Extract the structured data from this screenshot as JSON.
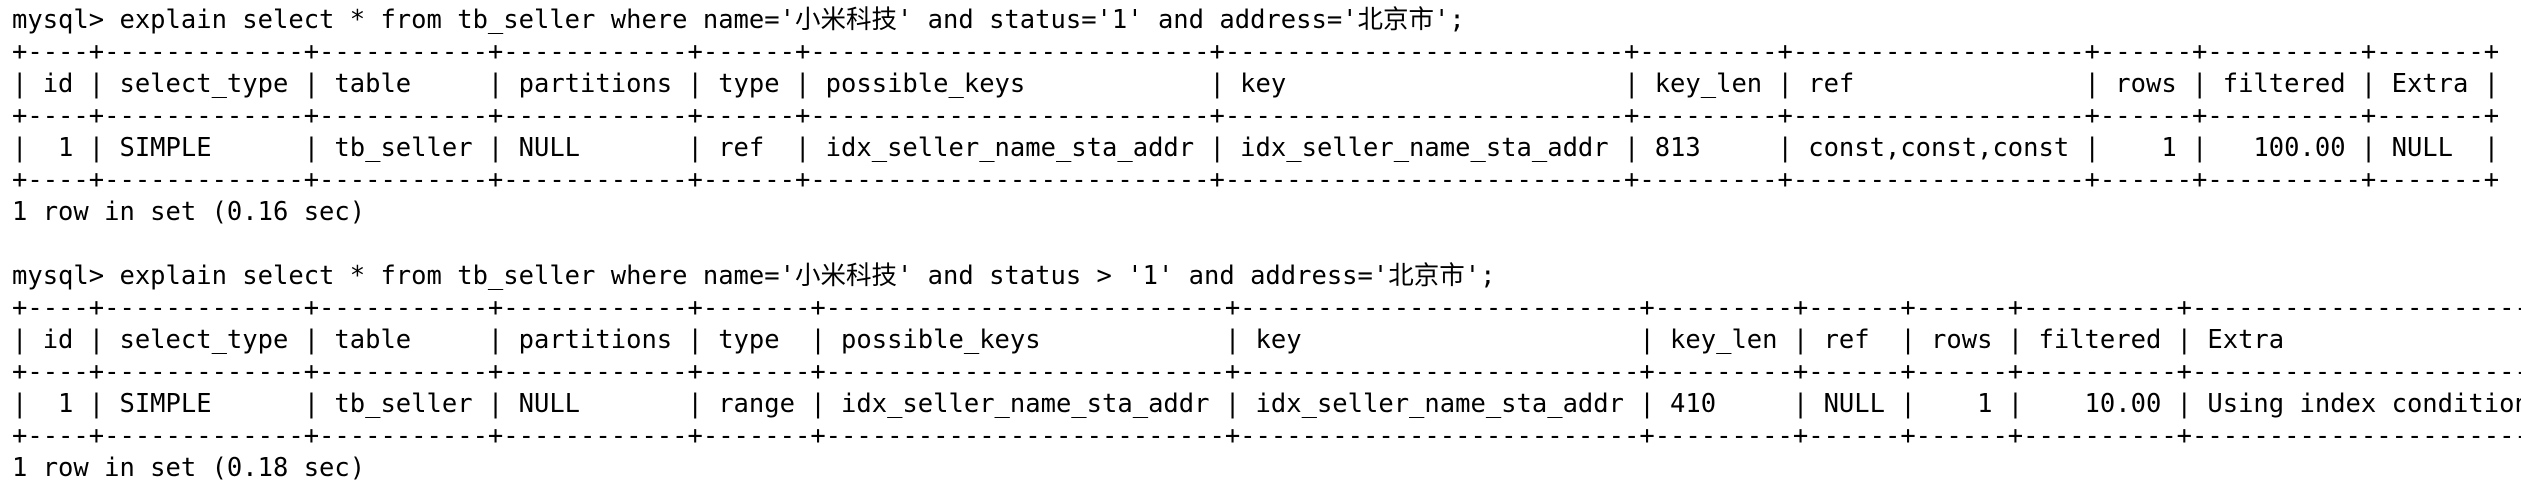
{
  "terminal": {
    "query1": {
      "command": "mysql> explain select * from tb_seller where name='小米科技' and status='1' and address='北京市';",
      "border": "+----+-------------+-----------+------------+------+--------------------------+--------------------------+---------+-------------------+------+----------+-------+",
      "header": "| id | select_type | table     | partitions | type | possible_keys            | key                      | key_len | ref               | rows | filtered | Extra |",
      "row": "|  1 | SIMPLE      | tb_seller | NULL       | ref  | idx_seller_name_sta_addr | idx_seller_name_sta_addr | 813     | const,const,const |    1 |   100.00 | NULL  |",
      "result": "1 row in set (0.16 sec)"
    },
    "query2": {
      "command": "mysql> explain select * from tb_seller where name='小米科技' and status > '1' and address='北京市';",
      "border": "+----+-------------+-----------+------------+-------+--------------------------+--------------------------+---------+------+------+----------+-----------------------+",
      "header": "| id | select_type | table     | partitions | type  | possible_keys            | key                      | key_len | ref  | rows | filtered | Extra                 |",
      "row": "|  1 | SIMPLE      | tb_seller | NULL       | range | idx_seller_name_sta_addr | idx_seller_name_sta_addr | 410     | NULL |    1 |    10.00 | Using index condition |",
      "result": "1 row in set (0.18 sec)"
    }
  }
}
